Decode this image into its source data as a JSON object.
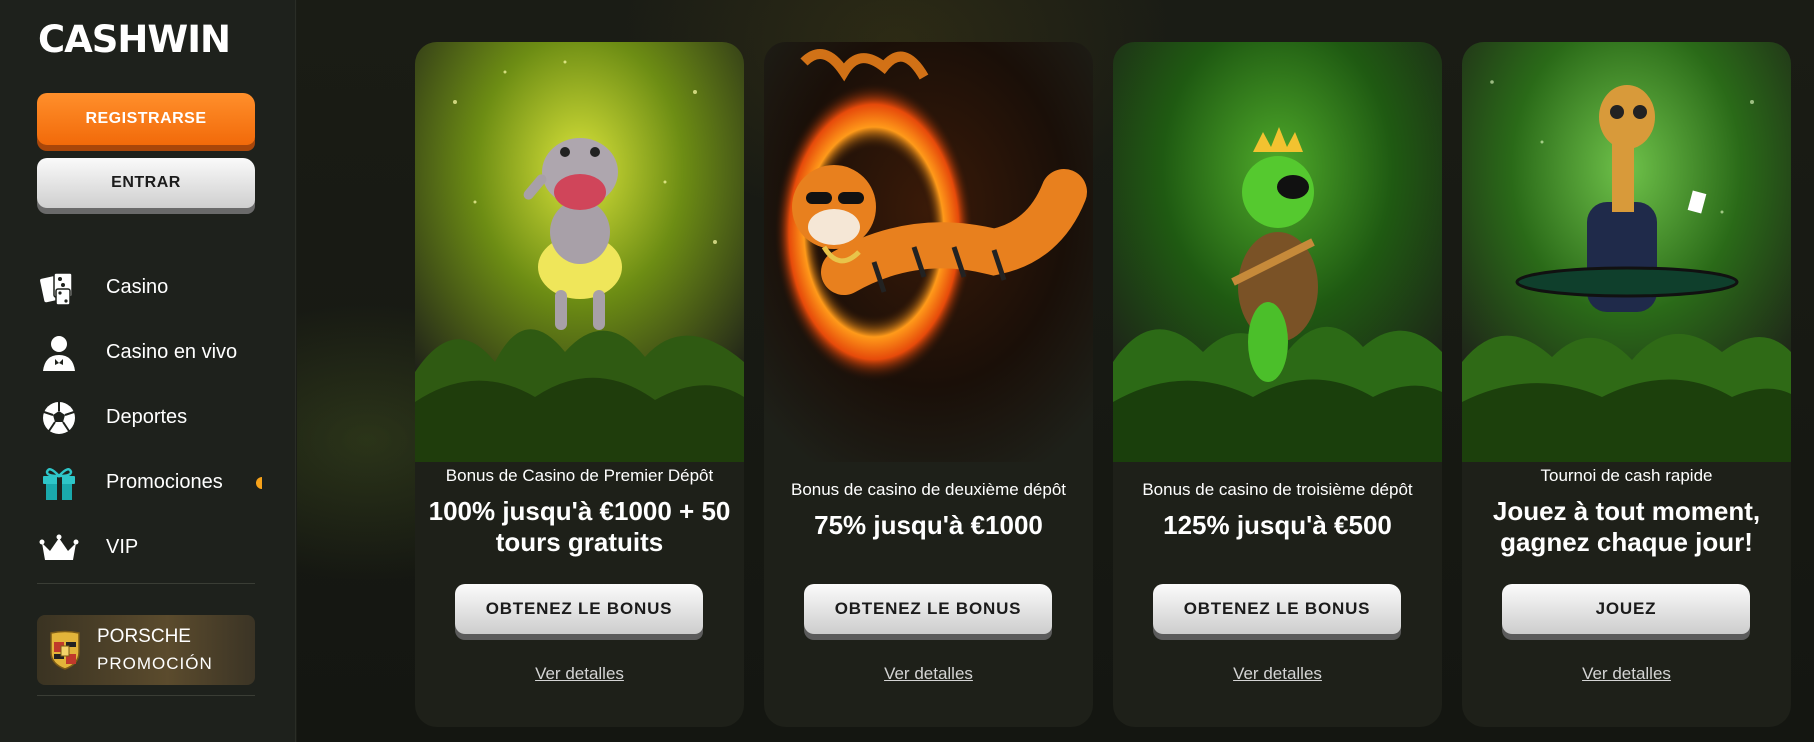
{
  "sidebar": {
    "logo": "CASHWIN",
    "register_label": "REGISTRARSE",
    "login_label": "ENTRAR",
    "items": [
      {
        "label": "Casino",
        "icon": "cards-icon"
      },
      {
        "label": "Casino en vivo",
        "icon": "dealer-icon"
      },
      {
        "label": "Deportes",
        "icon": "soccer-ball-icon"
      },
      {
        "label": "Promociones",
        "icon": "gift-icon",
        "badge": true
      },
      {
        "label": "VIP",
        "icon": "crown-icon"
      }
    ],
    "promo": {
      "line1": "PORSCHE",
      "line2": "PROMOCIÓN",
      "icon": "porsche-crest-icon"
    }
  },
  "cards": [
    {
      "subtitle": "Bonus de Casino de Premier Dépôt",
      "title": "100% jusqu'à €1000 + 50 tours gratuits",
      "button": "OBTENEZ LE BONUS",
      "link": "Ver detalles",
      "art": "hippo-dancing"
    },
    {
      "subtitle": "Bonus de casino de deuxième dépôt",
      "title": "75% jusqu'à €1000",
      "button": "OBTENEZ LE BONUS",
      "link": "Ver detalles",
      "art": "tiger-fire-ring"
    },
    {
      "subtitle": "Bonus de casino de troisième dépôt",
      "title": "125% jusqu'à €500",
      "button": "OBTENEZ LE BONUS",
      "link": "Ver detalles",
      "art": "turtle-king"
    },
    {
      "subtitle": "Tournoi de cash rapide",
      "title": "Jouez à tout moment, gagnez chaque jour!",
      "button": "JOUEZ",
      "link": "Ver detalles",
      "art": "giraffe-poker"
    }
  ],
  "colors": {
    "accent": "#f26a0a",
    "badge": "#f7a21a",
    "sidebar_bg": "#1e211c",
    "card_bg": "#1e2019"
  }
}
